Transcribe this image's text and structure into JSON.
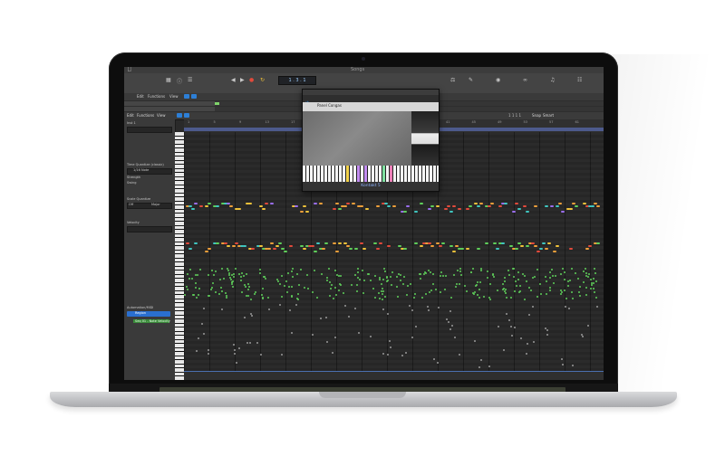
{
  "app": {
    "window_title": "Songs",
    "control_bar": {
      "icons": [
        "library-icon",
        "inspector-icon",
        "toolbar-icon",
        "smart-controls-icon",
        "mixer-icon",
        "editors-icon",
        "rewind-icon",
        "play-icon",
        "record-icon",
        "cycle-icon"
      ],
      "lcd_text": "1 . 3 . 1"
    },
    "track_header": {
      "labels": [
        "Edit",
        "Functions",
        "View"
      ]
    },
    "editor": {
      "labels": [
        "Edit",
        "Functions",
        "View"
      ],
      "ruler_numbers": [
        "1",
        "5",
        "9",
        "13",
        "17",
        "21",
        "25",
        "29",
        "33",
        "37",
        "41",
        "45",
        "49",
        "53",
        "57",
        "61"
      ],
      "snap_label": "Snap",
      "snap_value": "Smart",
      "drag_label": "Drag",
      "drag_value": "Overlap",
      "position_readout": "1 1 1 1"
    },
    "inspector": {
      "region_label": "Inst 1",
      "rows": [
        "Time Quantize (classic)",
        "1/16 Note",
        "Strength",
        "Swing",
        "Scale Quantize",
        "Off",
        "Major",
        "Velocity"
      ],
      "automation_label": "Automation/MIDI",
      "automation_value": "Region",
      "automation_param": "Seq 01 - Note Velocity"
    },
    "plugin": {
      "title": "Songs",
      "tabs": [
        "Compare",
        "Copy",
        "Paste",
        "Undo",
        "Redo",
        "View",
        "Editor"
      ],
      "active_tab": "Copy",
      "instrument_name": "Panel Congas",
      "footer": "Kontakt 5"
    }
  }
}
